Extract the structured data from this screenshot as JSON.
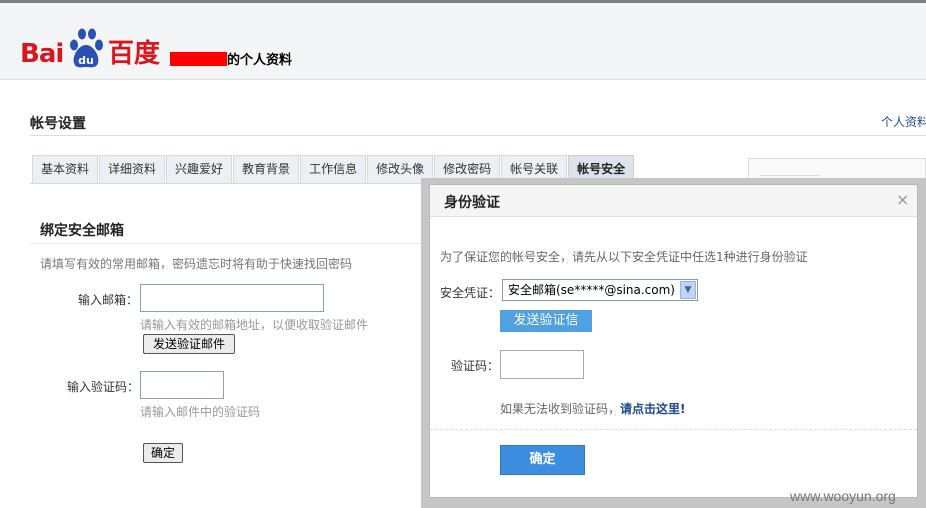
{
  "header": {
    "logo_text_left": "Bai",
    "logo_text_paw": "du",
    "logo_text_right": "百度",
    "profile_title": "的个人资料"
  },
  "section": {
    "title": "帐号设置",
    "profile_link": "个人资料"
  },
  "tabs": [
    {
      "label": "基本资料"
    },
    {
      "label": "详细资料"
    },
    {
      "label": "兴趣爱好"
    },
    {
      "label": "教育背景"
    },
    {
      "label": "工作信息"
    },
    {
      "label": "修改头像"
    },
    {
      "label": "修改密码"
    },
    {
      "label": "帐号关联"
    },
    {
      "label": "帐号安全"
    }
  ],
  "bind_email": {
    "title": "绑定安全邮箱",
    "description": "请填写有效的常用邮箱，密码遗忘时将有助于快速找回密码",
    "email_label": "输入邮箱：",
    "email_value": "",
    "email_hint": "请输入有效的邮箱地址，以便收取验证邮件",
    "send_button": "发送验证邮件",
    "code_label": "输入验证码：",
    "code_value": "",
    "code_hint": "请输入邮件中的验证码",
    "confirm_button": "确定"
  },
  "modal": {
    "title": "身份验证",
    "close": "×",
    "description": "为了保证您的帐号安全，请先从以下安全凭证中任选1种进行身份验证",
    "credential_label": "安全凭证：",
    "credential_selected": "安全邮箱(se*****@sina.com)",
    "send_button": "发送验证信",
    "code_label": "验证码：",
    "code_value": "",
    "help_text": "如果无法收到验证码，",
    "help_link": "请点击这里!",
    "confirm_button": "确定"
  },
  "watermark": "www.wooyun.org",
  "colors": {
    "brand_red": "#d7161d",
    "brand_blue": "#2a4fb5",
    "redaction": "#ff0000",
    "modal_button": "#3d8de0",
    "send_button": "#4fa1e2"
  }
}
